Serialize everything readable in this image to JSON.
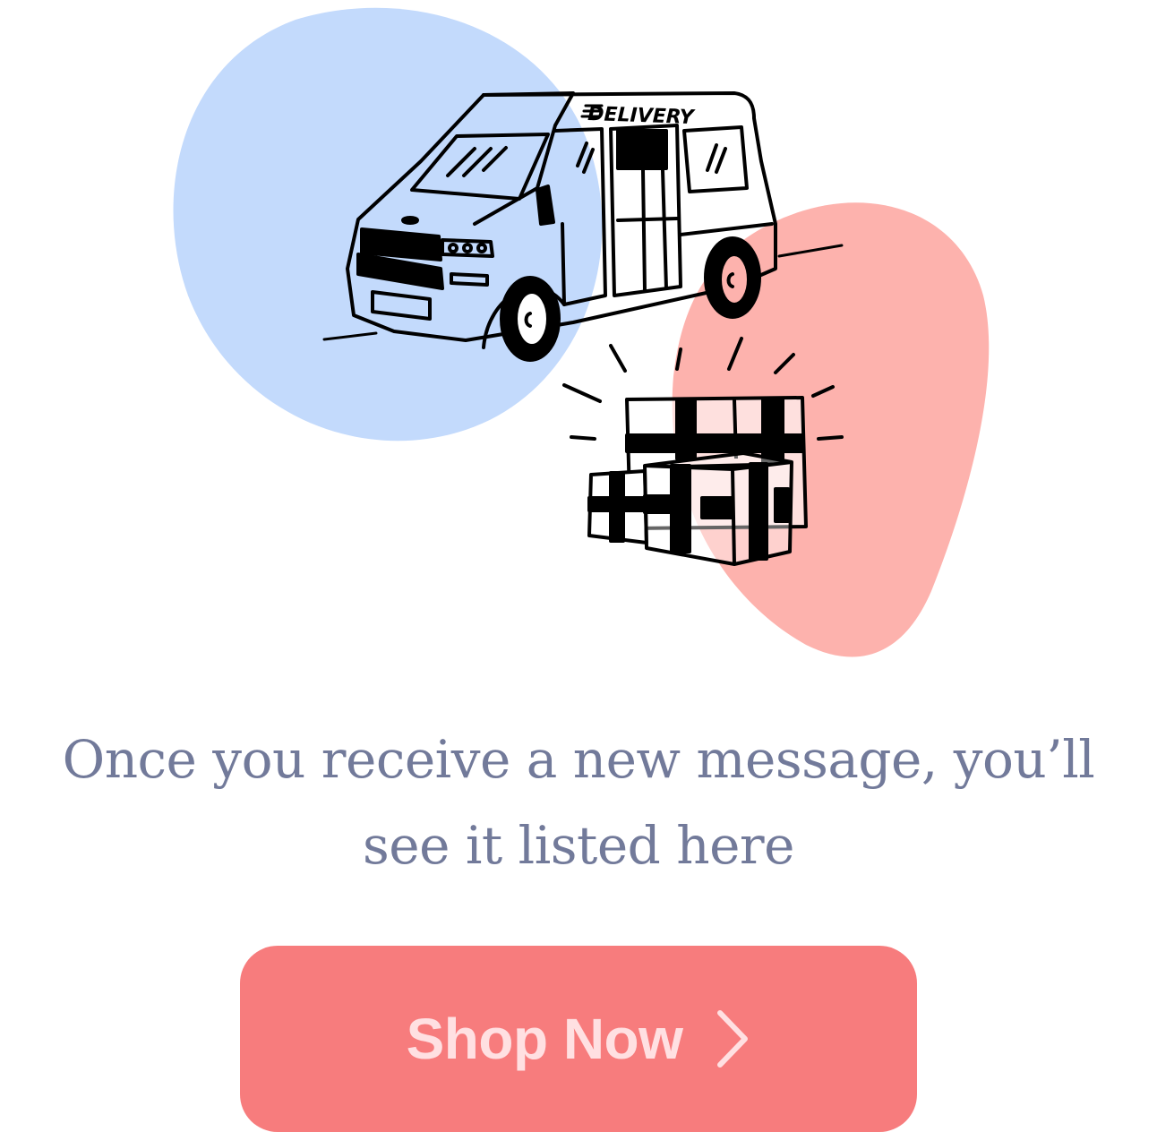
{
  "illustration": {
    "van_lettering": "DELIVERY",
    "colors": {
      "blue_blob": "#c3dafc",
      "pink_blob": "#fdb2ad",
      "ink": "#000000"
    }
  },
  "empty_state": {
    "message": "Once you receive a new message, you’ll see it listed here"
  },
  "cta": {
    "label": "Shop Now",
    "icon": "chevron-right-icon",
    "background": "#f77c7d",
    "text_color": "#ffe0e2"
  }
}
